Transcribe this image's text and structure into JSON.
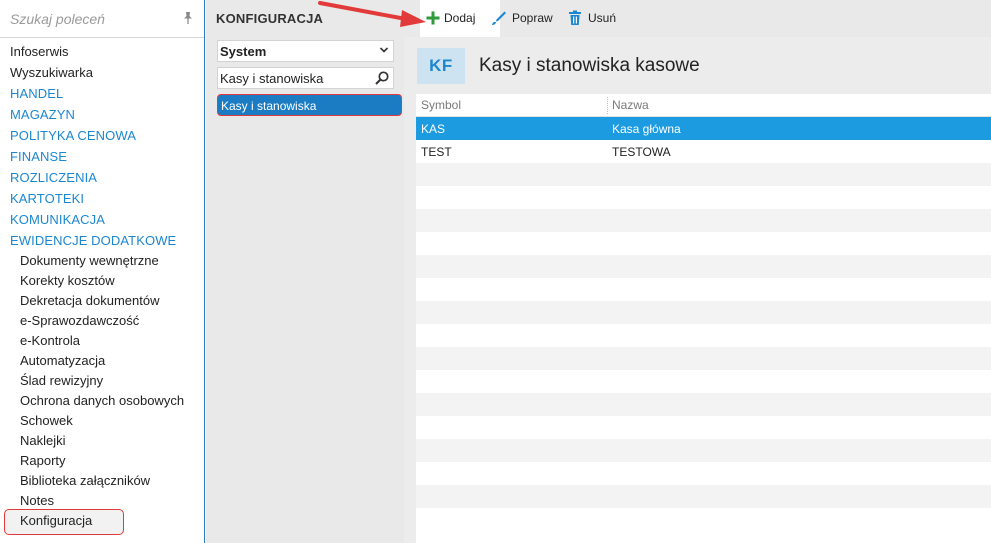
{
  "sidebar": {
    "search_placeholder": "Szukaj poleceń",
    "items": [
      {
        "label": "Infoserwis",
        "type": "plain"
      },
      {
        "label": "Wyszukiwarka",
        "type": "plain"
      },
      {
        "label": "HANDEL",
        "type": "category"
      },
      {
        "label": "MAGAZYN",
        "type": "category"
      },
      {
        "label": "POLITYKA CENOWA",
        "type": "category"
      },
      {
        "label": "FINANSE",
        "type": "category"
      },
      {
        "label": "ROZLICZENIA",
        "type": "category"
      },
      {
        "label": "KARTOTEKI",
        "type": "category"
      },
      {
        "label": "KOMUNIKACJA",
        "type": "category"
      },
      {
        "label": "EWIDENCJE DODATKOWE",
        "type": "category"
      }
    ],
    "subitems": [
      "Dokumenty wewnętrzne",
      "Korekty kosztów",
      "Dekretacja dokumentów",
      "e-Sprawozdawczość",
      "e-Kontrola",
      "Automatyzacja",
      "Ślad rewizyjny",
      "Ochrona danych osobowych",
      "Schowek",
      "Naklejki",
      "Raporty",
      "Biblioteka załączników",
      "Notes",
      "Konfiguracja"
    ]
  },
  "config_panel": {
    "title": "KONFIGURACJA",
    "select_value": "System",
    "filter_value": "Kasy i stanowiska",
    "tree_item": "Kasy i stanowiska"
  },
  "toolbar": {
    "add_label": "Dodaj",
    "edit_label": "Popraw",
    "delete_label": "Usuń"
  },
  "main": {
    "badge": "KF",
    "title": "Kasy i stanowiska kasowe",
    "columns": [
      "Symbol",
      "Nazwa"
    ],
    "rows": [
      {
        "symbol": "KAS",
        "nazwa": "Kasa główna",
        "selected": true
      },
      {
        "symbol": "TEST",
        "nazwa": "TESTOWA",
        "selected": false
      }
    ]
  },
  "colors": {
    "accent": "#1c87d1",
    "selection": "#1c9be0",
    "annotation": "#e23a3a",
    "add_icon": "#2e9a3a"
  },
  "icons": {
    "pin": "pin-icon",
    "chevron": "chevron-down-icon",
    "search": "search-icon",
    "add": "plus-icon",
    "edit": "pencil-icon",
    "delete": "trash-icon"
  }
}
